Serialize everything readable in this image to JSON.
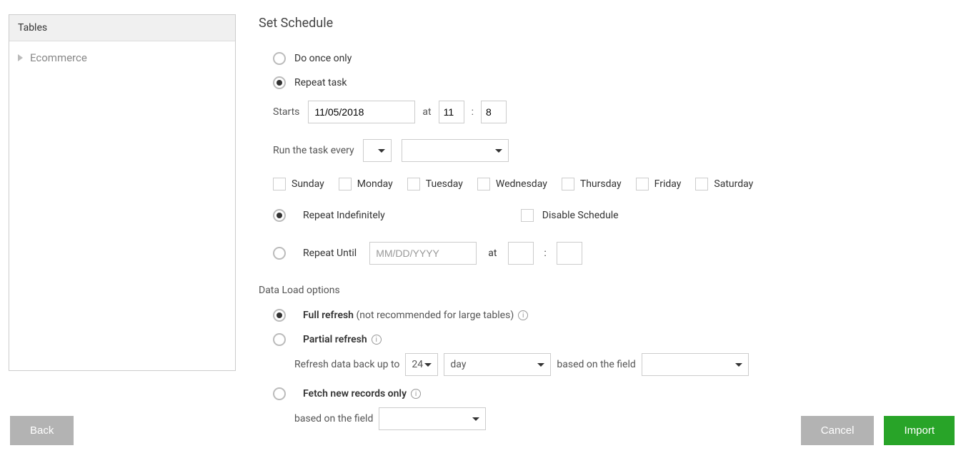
{
  "sidebar": {
    "header": "Tables",
    "items": [
      {
        "label": "Ecommerce"
      }
    ]
  },
  "schedule": {
    "title": "Set Schedule",
    "do_once_label": "Do once only",
    "repeat_task_label": "Repeat task",
    "starts_label": "Starts",
    "start_date": "11/05/2018",
    "at_label": "at",
    "time_separator": ":",
    "start_hour": "11",
    "start_minute": "8",
    "run_every_label": "Run the task every",
    "run_every_value": "",
    "run_every_unit": "",
    "days": [
      "Sunday",
      "Monday",
      "Tuesday",
      "Wednesday",
      "Thursday",
      "Friday",
      "Saturday"
    ],
    "repeat_indef_label": "Repeat Indefinitely",
    "disable_schedule_label": "Disable Schedule",
    "repeat_until_label": "Repeat Until",
    "until_date_placeholder": "MM/DD/YYYY",
    "data_load_title": "Data Load options",
    "full_refresh_label": "Full refresh",
    "full_refresh_note": " (not recommended for large tables)",
    "partial_refresh_label": "Partial refresh",
    "refresh_back_label": "Refresh data back up to",
    "refresh_back_value": "24",
    "refresh_back_unit": "day",
    "based_on_field_label": "based on the field",
    "fetch_new_label": "Fetch new records only"
  },
  "buttons": {
    "back": "Back",
    "cancel": "Cancel",
    "import": "Import"
  }
}
